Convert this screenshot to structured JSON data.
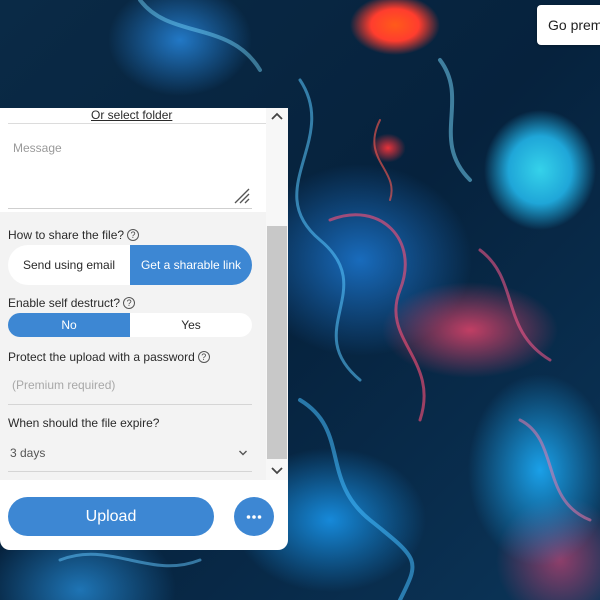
{
  "header": {
    "premium_label": "Go premium"
  },
  "upload_form": {
    "folder_link": "Or select folder",
    "message_placeholder": "Message",
    "share": {
      "label": "How to share the file?",
      "options": [
        "Send using email",
        "Get a sharable link"
      ],
      "selected": "Get a sharable link"
    },
    "self_destruct": {
      "label": "Enable self destruct?",
      "options": [
        "No",
        "Yes"
      ],
      "selected": "No"
    },
    "password": {
      "label": "Protect the upload with a password",
      "placeholder": "(Premium required)"
    },
    "expire": {
      "label": "When should the file expire?",
      "value": "3 days"
    },
    "upload_label": "Upload",
    "more_label": "•••"
  },
  "colors": {
    "accent": "#3d87d3",
    "panel_bg": "#f3f3f3"
  }
}
